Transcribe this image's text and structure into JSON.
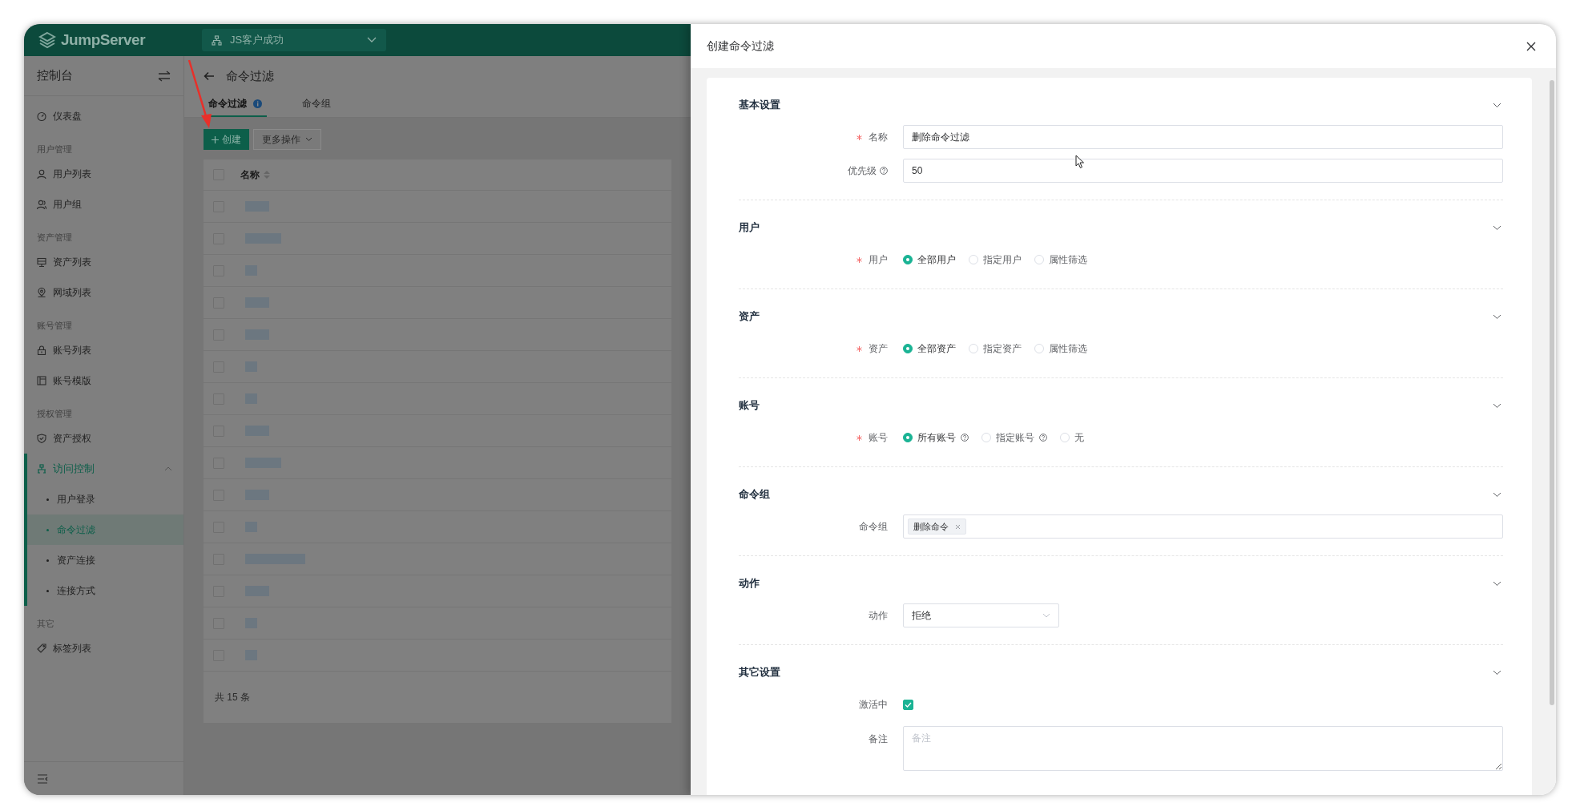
{
  "top_bar": {
    "brand": "JumpServer",
    "organization": "JS客户成功"
  },
  "sidebar": {
    "title": "控制台",
    "items": [
      {
        "kind": "item",
        "label": "仪表盘",
        "selected": false
      },
      {
        "kind": "heading",
        "label": "用户管理"
      },
      {
        "kind": "item",
        "label": "用户列表",
        "selected": false
      },
      {
        "kind": "item",
        "label": "用户组",
        "selected": false
      },
      {
        "kind": "heading",
        "label": "资产管理"
      },
      {
        "kind": "item",
        "label": "资产列表",
        "selected": false
      },
      {
        "kind": "item",
        "label": "网域列表",
        "selected": false
      },
      {
        "kind": "heading",
        "label": "账号管理"
      },
      {
        "kind": "item",
        "label": "账号列表",
        "selected": false
      },
      {
        "kind": "item",
        "label": "账号模版",
        "selected": false
      },
      {
        "kind": "heading",
        "label": "授权管理"
      },
      {
        "kind": "item",
        "label": "资产授权",
        "selected": false
      },
      {
        "kind": "menu",
        "label": "访问控制",
        "expanded": true,
        "children": [
          {
            "label": "用户登录",
            "selected": false
          },
          {
            "label": "命令过滤",
            "selected": true
          },
          {
            "label": "资产连接",
            "selected": false
          },
          {
            "label": "连接方式",
            "selected": false
          }
        ]
      },
      {
        "kind": "heading",
        "label": "其它"
      },
      {
        "kind": "item",
        "label": "标签列表",
        "selected": false
      }
    ]
  },
  "page": {
    "title": "命令过滤",
    "tabs": [
      {
        "label": "命令过滤",
        "selected": true,
        "info": true
      },
      {
        "label": "命令组",
        "selected": false,
        "info": false
      }
    ],
    "create_button": "创建",
    "more_button": "更多操作",
    "table": {
      "columns": [
        "名称"
      ],
      "header_checked": false,
      "rows": [
        {
          "checked": false
        },
        {
          "checked": false
        },
        {
          "checked": false
        },
        {
          "checked": false
        },
        {
          "checked": false
        },
        {
          "checked": false
        },
        {
          "checked": false
        },
        {
          "checked": false
        },
        {
          "checked": false
        },
        {
          "checked": false
        },
        {
          "checked": false
        },
        {
          "checked": false
        },
        {
          "checked": false
        },
        {
          "checked": false
        },
        {
          "checked": false
        }
      ]
    },
    "footer": "共 15 条"
  },
  "drawer": {
    "title": "创建命令过滤",
    "sections": [
      {
        "title": "基本设置",
        "fields": [
          {
            "kind": "text",
            "label": "名称",
            "required": true,
            "help": false,
            "value": "删除命令过滤"
          },
          {
            "kind": "text",
            "label": "优先级",
            "required": false,
            "help": true,
            "value": "50"
          }
        ]
      },
      {
        "title": "用户",
        "fields": [
          {
            "kind": "radio",
            "label": "用户",
            "required": true,
            "help": false,
            "options": [
              {
                "label": "全部用户",
                "selected": true,
                "help": false
              },
              {
                "label": "指定用户",
                "selected": false,
                "help": false
              },
              {
                "label": "属性筛选",
                "selected": false,
                "help": false
              }
            ]
          }
        ]
      },
      {
        "title": "资产",
        "fields": [
          {
            "kind": "radio",
            "label": "资产",
            "required": true,
            "help": false,
            "options": [
              {
                "label": "全部资产",
                "selected": true,
                "help": false
              },
              {
                "label": "指定资产",
                "selected": false,
                "help": false
              },
              {
                "label": "属性筛选",
                "selected": false,
                "help": false
              }
            ]
          }
        ]
      },
      {
        "title": "账号",
        "fields": [
          {
            "kind": "radio",
            "label": "账号",
            "required": true,
            "help": false,
            "options": [
              {
                "label": "所有账号",
                "selected": true,
                "help": true
              },
              {
                "label": "指定账号",
                "selected": false,
                "help": true
              },
              {
                "label": "无",
                "selected": false,
                "help": false
              }
            ]
          }
        ]
      },
      {
        "title": "命令组",
        "fields": [
          {
            "kind": "tags",
            "label": "命令组",
            "required": false,
            "help": false,
            "tags": [
              "删除命令"
            ]
          }
        ]
      },
      {
        "title": "动作",
        "fields": [
          {
            "kind": "select",
            "label": "动作",
            "required": false,
            "help": false,
            "value": "拒绝"
          }
        ]
      },
      {
        "title": "其它设置",
        "fields": [
          {
            "kind": "checkbox",
            "label": "激活中",
            "required": false,
            "help": false,
            "checked": true
          },
          {
            "kind": "textarea",
            "label": "备注",
            "required": false,
            "help": false,
            "placeholder": "备注"
          }
        ]
      }
    ]
  }
}
